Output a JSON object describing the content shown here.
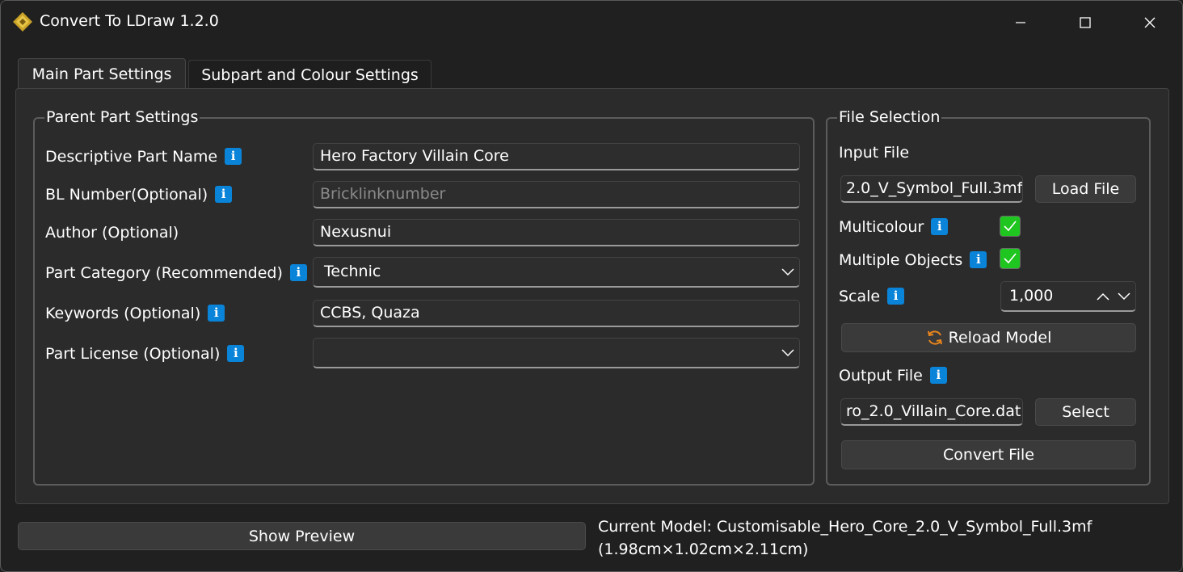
{
  "window": {
    "title": "Convert To LDraw 1.2.0",
    "controls": [
      "minimize-icon",
      "maximize-icon",
      "close-icon"
    ]
  },
  "tabs": [
    {
      "label": "Main Part Settings",
      "active": true
    },
    {
      "label": "Subpart and Colour Settings",
      "active": false
    }
  ],
  "parent_settings": {
    "title": "Parent Part Settings",
    "fields": {
      "part_name": {
        "label": "Descriptive Part Name",
        "value": "Hero Factory Villain Core"
      },
      "bl_number": {
        "label": "BL Number(Optional)",
        "value": "",
        "placeholder": "Bricklinknumber"
      },
      "author": {
        "label": "Author (Optional)",
        "value": "Nexusnui"
      },
      "category": {
        "label": "Part Category (Recommended)",
        "value": "Technic"
      },
      "keywords": {
        "label": "Keywords (Optional)",
        "value": "CCBS, Quaza"
      },
      "license": {
        "label": "Part License (Optional)",
        "value": ""
      }
    }
  },
  "file_selection": {
    "title": "File Selection",
    "input_label": "Input File",
    "input_value": "2.0_V_Symbol_Full.3mf",
    "load_button": "Load File",
    "multicolour_label": "Multicolour",
    "multicolour_checked": true,
    "multiple_objects_label": "Multiple Objects",
    "multiple_objects_checked": true,
    "scale_label": "Scale",
    "scale_value": "1,000",
    "reload_button": "Reload Model",
    "output_label": "Output File",
    "output_value": "ro_2.0_Villain_Core.dat",
    "select_button": "Select",
    "convert_button": "Convert File"
  },
  "footer": {
    "preview_button": "Show Preview",
    "current_model_line1": "Current Model: Customisable_Hero_Core_2.0_V_Symbol_Full.3mf",
    "current_model_line2": "(1.98cm×1.02cm×2.11cm)"
  },
  "colors": {
    "accent_info": "#0a84d8",
    "check_green": "#1fc61f",
    "reload_icon": "#e8861c",
    "background": "#202020",
    "panel": "#2b2b2b"
  },
  "icons": {
    "info": "i"
  }
}
